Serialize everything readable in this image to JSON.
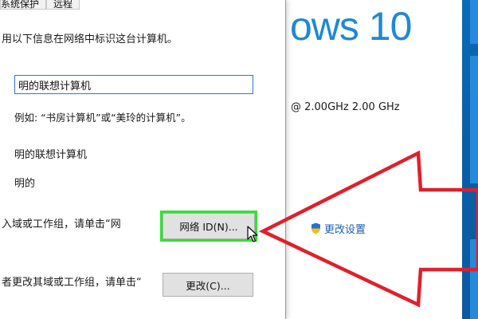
{
  "dialog": {
    "tabs": [
      {
        "label": "系统保护"
      },
      {
        "label": "远程"
      }
    ],
    "description_prompt": "用以下信息在网络中标识这台计算机。",
    "computer_description_value": "明的联想计算机",
    "example_text": "例如: “书房计算机”或“美玲的计算机”。",
    "full_computer_name": "明的联想计算机",
    "workgroup": "明的",
    "join_prompt": "入域或工作组，请单击“网",
    "network_id_button": "网络 ID(N)...",
    "rename_prompt": "者更改其域或工作组，请单击“",
    "change_button": "更改(C)..."
  },
  "background_window": {
    "windows_logo_text": "ows 10",
    "processor_info": "@ 2.00GHz   2.00 GHz",
    "change_settings_link": "更改设置"
  },
  "icons": {
    "shield": "uac-shield-icon",
    "cursor": "mouse-pointer-icon",
    "annotation": "red-arrow-annotation"
  },
  "colors": {
    "highlight": "#33e033",
    "annotation_arrow": "#e0202a",
    "link": "#1a5fb4",
    "windows_blue": "#1e88d8"
  }
}
